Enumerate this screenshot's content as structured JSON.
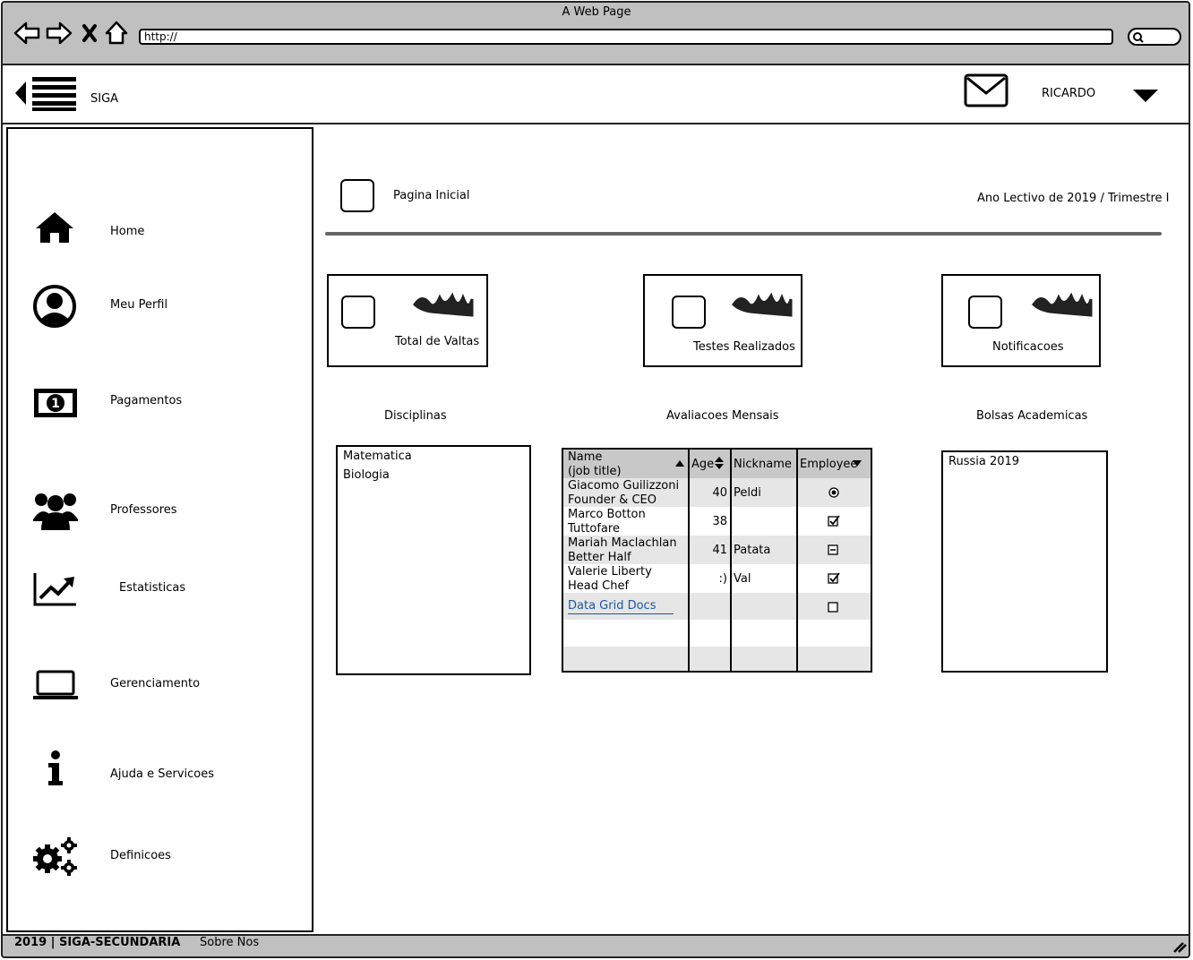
{
  "browser": {
    "title": "A Web Page",
    "url": "http://"
  },
  "app": {
    "name": "SIGA",
    "user": "RICARDO"
  },
  "sidebar": {
    "items": [
      {
        "label": "Home",
        "icon": "home-icon"
      },
      {
        "label": "Meu Perfil",
        "icon": "user-icon"
      },
      {
        "label": "Pagamentos",
        "icon": "money-icon"
      },
      {
        "label": "Professores",
        "icon": "users-icon"
      },
      {
        "label": "Estatisticas",
        "icon": "chart-line-icon"
      },
      {
        "label": "Gerenciamento",
        "icon": "laptop-icon"
      },
      {
        "label": "Ajuda e Servicoes",
        "icon": "info-icon"
      },
      {
        "label": "Definicoes",
        "icon": "gears-icon"
      }
    ]
  },
  "main": {
    "page_title": "Pagina Inicial",
    "period": "Ano Lectivo de 2019 / Trimestre I",
    "cards": [
      {
        "label": "Total de Valtas"
      },
      {
        "label": "Testes Realizados"
      },
      {
        "label": "Notificacoes"
      }
    ],
    "disciplinas": {
      "title": "Disciplinas",
      "items": [
        "Matematica",
        "Biologia"
      ]
    },
    "avaliacoes": {
      "title": "Avaliacoes Mensais",
      "columns": [
        "Name\n(job title)",
        "Age",
        "Nickname",
        "Employee"
      ],
      "rows": [
        {
          "name": "Giacomo Guilizzoni",
          "title": "Founder & CEO",
          "age": "40",
          "nickname": "Peldi",
          "employee": "radio-selected"
        },
        {
          "name": "Marco Botton",
          "title": "Tuttofare",
          "age": "38",
          "nickname": "",
          "employee": "checked"
        },
        {
          "name": "Mariah Maclachlan",
          "title": "Better Half",
          "age": "41",
          "nickname": "Patata",
          "employee": "indeterminate"
        },
        {
          "name": "Valerie Liberty",
          "title": "Head Chef",
          "age": ":)",
          "nickname": "Val",
          "employee": "checked"
        }
      ],
      "link": "Data Grid Docs"
    },
    "bolsas": {
      "title": "Bolsas Academicas",
      "items": [
        "Russia 2019"
      ]
    }
  },
  "footer": {
    "copyright": "2019 | SIGA-SECUNDARIA",
    "about": "Sobre Nos"
  }
}
